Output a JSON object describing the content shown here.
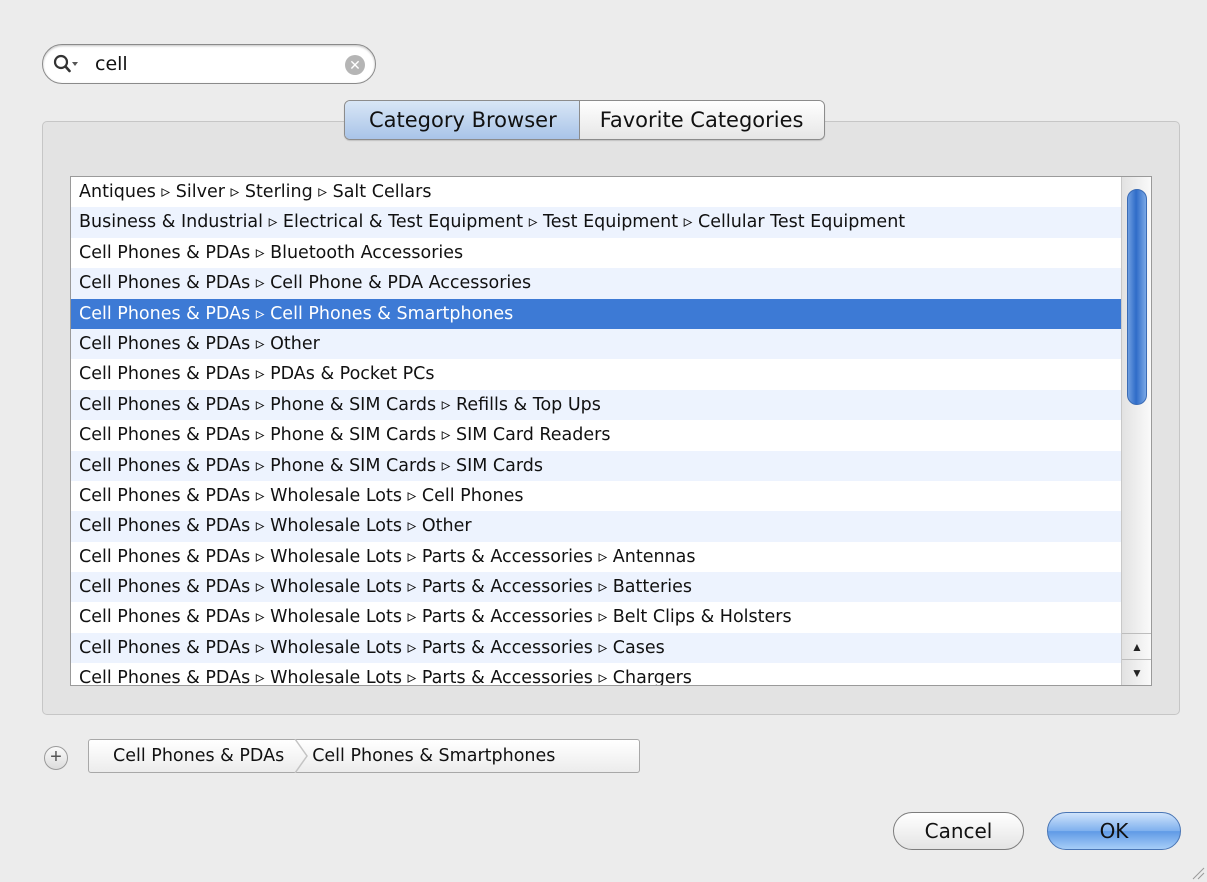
{
  "search": {
    "value": "cell",
    "clear_glyph": "✕"
  },
  "tabs": [
    {
      "label": "Category Browser",
      "active": true
    },
    {
      "label": "Favorite Categories",
      "active": false
    }
  ],
  "list": {
    "separator": "▹",
    "rows": [
      "Antiques ▹ Silver ▹ Sterling ▹ Salt Cellars",
      "Business & Industrial ▹ Electrical & Test Equipment ▹ Test Equipment ▹ Cellular Test Equipment",
      "Cell Phones & PDAs ▹ Bluetooth Accessories",
      "Cell Phones & PDAs ▹ Cell Phone & PDA Accessories",
      "Cell Phones & PDAs ▹ Cell Phones & Smartphones",
      "Cell Phones & PDAs ▹ Other",
      "Cell Phones & PDAs ▹ PDAs & Pocket PCs",
      "Cell Phones & PDAs ▹ Phone & SIM Cards ▹ Refills & Top Ups",
      "Cell Phones & PDAs ▹ Phone & SIM Cards ▹ SIM Card Readers",
      "Cell Phones & PDAs ▹ Phone & SIM Cards ▹ SIM Cards",
      "Cell Phones & PDAs ▹ Wholesale Lots ▹ Cell Phones",
      "Cell Phones & PDAs ▹ Wholesale Lots ▹ Other",
      "Cell Phones & PDAs ▹ Wholesale Lots ▹ Parts & Accessories ▹ Antennas",
      "Cell Phones & PDAs ▹ Wholesale Lots ▹ Parts & Accessories ▹ Batteries",
      "Cell Phones & PDAs ▹ Wholesale Lots ▹ Parts & Accessories ▹ Belt Clips & Holsters",
      "Cell Phones & PDAs ▹ Wholesale Lots ▹ Parts & Accessories ▹ Cases",
      "Cell Phones & PDAs ▹ Wholesale Lots ▹ Parts & Accessories ▹ Chargers"
    ],
    "selected_index": 4
  },
  "scrollbar": {
    "up_glyph": "▲",
    "down_glyph": "▼"
  },
  "path": {
    "add_glyph": "+",
    "crumbs": [
      "Cell Phones & PDAs",
      "Cell Phones & Smartphones"
    ]
  },
  "buttons": {
    "cancel_label": "Cancel",
    "ok_label": "OK"
  },
  "colors": {
    "selection": "#3d7ad5",
    "row_stripe": "#edf3fe",
    "window_bg": "#ececec"
  }
}
